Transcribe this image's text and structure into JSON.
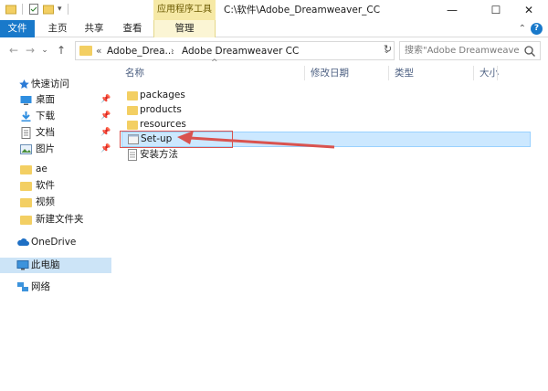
{
  "window": {
    "tools_context_label": "应用程序工具",
    "title": "C:\\软件\\Adobe_Dreamweaver_CC",
    "minimize": "—",
    "maximize": "☐",
    "close": "✕"
  },
  "ribbon": {
    "tabs": [
      "文件",
      "主页",
      "共享",
      "查看"
    ],
    "manage_tab": "管理",
    "collapse_glyph": "⌃",
    "help_glyph": "?"
  },
  "address": {
    "back": "←",
    "forward": "→",
    "recent": "⌄",
    "up": "↑",
    "prefix": "«",
    "crumbs": [
      "Adobe_Drea...",
      "Adobe Dreamweaver CC"
    ],
    "separator": "›",
    "dropdown": "⌄",
    "refresh": "↻",
    "search_placeholder": "搜索\"Adobe Dreamweaver ..."
  },
  "nav": {
    "quick_access": "快速访问",
    "pinned": [
      {
        "label": "桌面",
        "icon": "desktop-icon"
      },
      {
        "label": "下载",
        "icon": "download-icon"
      },
      {
        "label": "文档",
        "icon": "document-icon"
      },
      {
        "label": "图片",
        "icon": "pictures-icon"
      }
    ],
    "folders": [
      "ae",
      "软件",
      "视频",
      "新建文件夹"
    ],
    "onedrive": "OneDrive",
    "this_pc": "此电脑",
    "network": "网络",
    "pin_glyph": "📌"
  },
  "columns": {
    "name": "名称",
    "modified": "修改日期",
    "type": "类型",
    "size": "大小"
  },
  "files": [
    {
      "name": "packages",
      "kind": "folder"
    },
    {
      "name": "products",
      "kind": "folder"
    },
    {
      "name": "resources",
      "kind": "folder"
    },
    {
      "name": "Set-up",
      "kind": "application",
      "selected": true
    },
    {
      "name": "安装方法",
      "kind": "text"
    }
  ],
  "colors": {
    "accent": "#1979ca",
    "selection": "#cce8ff",
    "annotation": "#d9534f",
    "folder": "#f3cf63"
  }
}
